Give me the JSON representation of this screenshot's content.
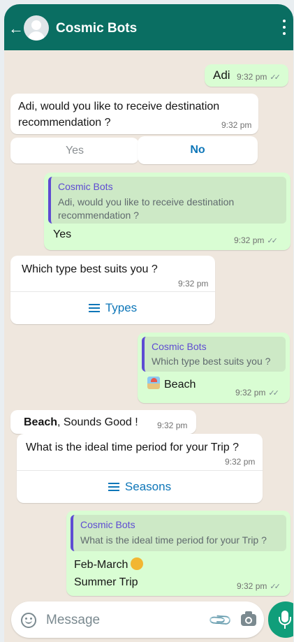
{
  "header": {
    "title": "Cosmic Bots"
  },
  "messages": {
    "m1": {
      "text": "Adi",
      "time": "9:32 pm"
    },
    "m2": {
      "text": "Adi, would you like to receive destination recommendation ?",
      "time": "9:32 pm"
    },
    "buttons": {
      "yes": "Yes",
      "no": "No"
    },
    "m3": {
      "quote_name": "Cosmic Bots",
      "quote_text": "Adi, would you like to receive destination recommendation ?",
      "text": "Yes",
      "time": "9:32 pm"
    },
    "m4": {
      "text": "Which type best suits you ?",
      "time": "9:32 pm",
      "list_label": "Types"
    },
    "m5": {
      "quote_name": "Cosmic Bots",
      "quote_text": "Which type best suits you ?",
      "text": "Beach",
      "time": "9:32 pm"
    },
    "m6": {
      "bold": "Beach",
      "text": ", Sounds Good !",
      "time": "9:32 pm"
    },
    "m7": {
      "text": "What is the ideal time period for your Trip ?",
      "time": "9:32 pm",
      "list_label": "Seasons"
    },
    "m8": {
      "quote_name": "Cosmic Bots",
      "quote_text": "What is the ideal time period for your Trip ?",
      "line1": "Feb-March",
      "line2": "Summer Trip",
      "time": "9:32 pm"
    }
  },
  "composer": {
    "placeholder": "Message"
  },
  "colors": {
    "header": "#0a6e62",
    "outgoing": "#d9fdd3",
    "accent_link": "#0d76b8",
    "quote_name": "#5e4bd3",
    "mic_button": "#109e7a"
  },
  "icons": [
    "back-arrow-icon",
    "avatar-icon",
    "more-vert-icon",
    "double-check-icon",
    "list-icon",
    "beach-icon",
    "smiley-icon",
    "attach-icon",
    "camera-icon",
    "mic-icon"
  ]
}
